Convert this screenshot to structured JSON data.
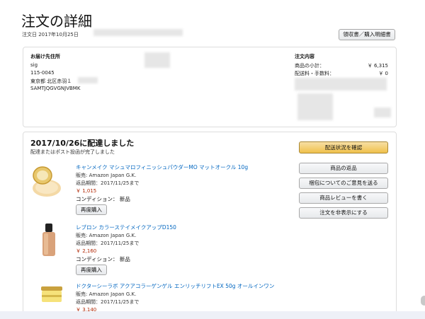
{
  "page": {
    "title": "注文の詳細",
    "order_date": "注文日 2017年10月25日",
    "receipt_button": "領収書／購入明細書"
  },
  "shipping": {
    "label": "お届け先住所",
    "name": "sig",
    "postal": "115-0045",
    "address": "東京都 北区赤羽１",
    "code": "SAMTJQGVGNJVBMK"
  },
  "summary": {
    "label": "注文内容",
    "subtotal_label": "商品の小計：",
    "subtotal_value": "￥ 6,315",
    "shipping_label": "配送料・手数料：",
    "shipping_value": "￥ 0"
  },
  "delivery": {
    "heading": "2017/10/26に配達しました",
    "subtext": "配達またはポスト投函が完了しました"
  },
  "actions": {
    "track": "配送状況を確認",
    "return": "商品の返品",
    "feedback": "梱包についてのご意見を送る",
    "review": "商品レビューを書く",
    "hide": "注文を非表示にする"
  },
  "items": [
    {
      "title": "キャンメイク マシュマロフィニッシュパウダーMO マットオークル 10g",
      "seller": "販売: Amazon Japan G.K.",
      "return_by": "返品期間：2017/11/25まで",
      "price": "￥ 1,015",
      "condition": "コンディション： 新品",
      "rebuy": "再度購入"
    },
    {
      "title": "レブロン カラーステイメイクアップD150",
      "seller": "販売: Amazon Japan G.K.",
      "return_by": "返品期間：2017/11/25まで",
      "price": "￥ 2,160",
      "condition": "コンディション： 新品",
      "rebuy": "再度購入"
    },
    {
      "title": "ドクターシーラボ アクアコラーゲンゲル エンリッチリフトEX 50g オールインワン",
      "seller": "販売: Amazon Japan G.K.",
      "return_by": "返品期間：2017/11/25まで",
      "price": "￥ 3,140"
    }
  ]
}
